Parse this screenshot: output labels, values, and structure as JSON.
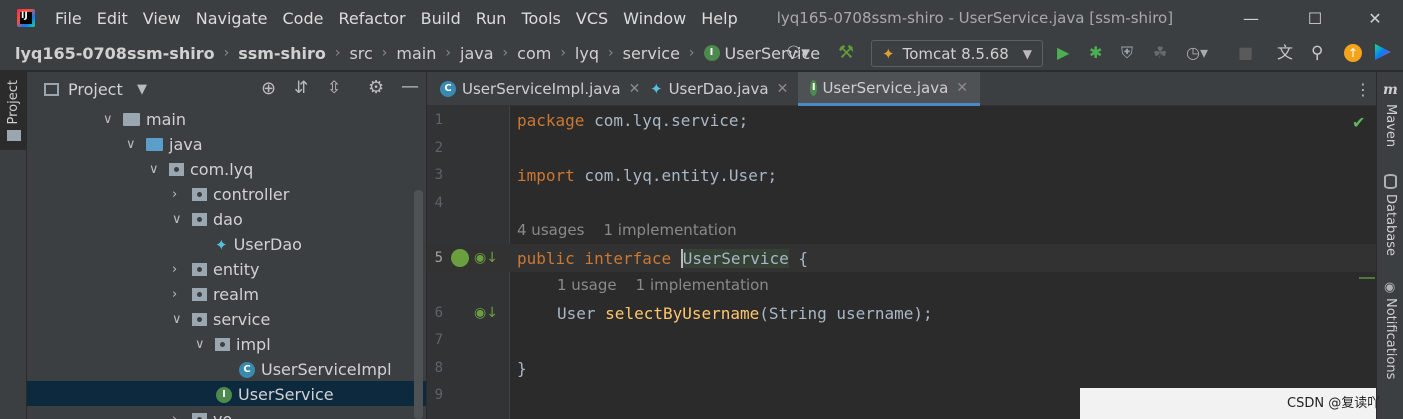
{
  "app": {
    "menu": [
      "File",
      "Edit",
      "View",
      "Navigate",
      "Code",
      "Refactor",
      "Build",
      "Run",
      "Tools",
      "VCS",
      "Window",
      "Help"
    ],
    "window_title": "lyq165-0708ssm-shiro - UserService.java [ssm-shiro]"
  },
  "breadcrumb": [
    "lyq165-0708ssm-shiro",
    "ssm-shiro",
    "src",
    "main",
    "java",
    "com",
    "lyq",
    "service",
    "UserService"
  ],
  "toolbar": {
    "run_config": "Tomcat 8.5.68"
  },
  "project_panel": {
    "title": "Project",
    "tree": [
      {
        "label": "main",
        "type": "folder",
        "expanded": true
      },
      {
        "label": "java",
        "type": "source-folder",
        "expanded": true
      },
      {
        "label": "com.lyq",
        "type": "package",
        "expanded": true
      },
      {
        "label": "controller",
        "type": "package",
        "expanded": false
      },
      {
        "label": "dao",
        "type": "package",
        "expanded": true
      },
      {
        "label": "UserDao",
        "type": "file"
      },
      {
        "label": "entity",
        "type": "package",
        "expanded": false
      },
      {
        "label": "realm",
        "type": "package",
        "expanded": false
      },
      {
        "label": "service",
        "type": "package",
        "expanded": true
      },
      {
        "label": "impl",
        "type": "package",
        "expanded": true
      },
      {
        "label": "UserServiceImpl",
        "type": "class"
      },
      {
        "label": "UserService",
        "type": "interface",
        "selected": true
      },
      {
        "label": "vo",
        "type": "package",
        "expanded": false
      }
    ]
  },
  "tabs": [
    {
      "label": "UserServiceImpl.java",
      "active": false
    },
    {
      "label": "UserDao.java",
      "active": false
    },
    {
      "label": "UserService.java",
      "active": true
    }
  ],
  "editor": {
    "line_numbers": [
      "1",
      "2",
      "3",
      "4",
      "5",
      "6",
      "7",
      "8",
      "9"
    ],
    "lines": {
      "l1_kw": "package",
      "l1_rest": " com.lyq.service;",
      "l3_kw": "import",
      "l3_rest": " com.lyq.entity.User;",
      "hint1": "4 usages    1 implementation",
      "l5_kw": "public interface ",
      "l5_name": "UserService",
      "l5_rest": " {",
      "hint2": "1 usage    1 implementation",
      "l6_type": "User ",
      "l6_fn": "selectByUsername",
      "l6_rest": "(String username);",
      "l8": "}"
    }
  },
  "right_tools": [
    "Maven",
    "Database",
    "Notifications"
  ],
  "left_tools": [
    "Project"
  ],
  "watermark": "CSDN @复读吖"
}
